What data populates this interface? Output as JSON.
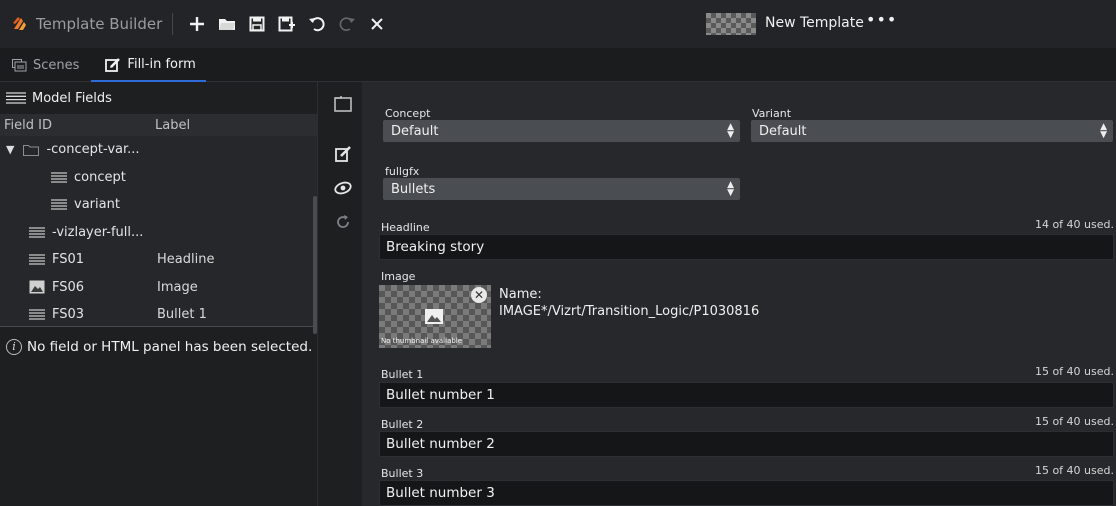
{
  "app": {
    "title": "Template Builder",
    "template_name": "New Template",
    "more": "•••"
  },
  "toolbar": {
    "items": [
      "add-icon",
      "open-folder-icon",
      "save-icon",
      "save-as-icon",
      "undo-icon",
      "redo-icon",
      "close-icon"
    ]
  },
  "tabs": [
    {
      "label": "Scenes"
    },
    {
      "label": "Fill-in form"
    }
  ],
  "left_panel": {
    "title": "Model Fields",
    "columns": {
      "field_id": "Field ID",
      "label": "Label"
    },
    "rows": [
      {
        "id": "-concept-var...",
        "label": "",
        "icon": "folder-icon",
        "indent": 0,
        "expanded": true
      },
      {
        "id": "concept",
        "label": "",
        "icon": "text-lines-icon",
        "indent": 1
      },
      {
        "id": "variant",
        "label": "",
        "icon": "text-lines-icon",
        "indent": 1
      },
      {
        "id": "-vizlayer-full...",
        "label": "",
        "icon": "text-lines-icon",
        "indent": 0
      },
      {
        "id": "FS01",
        "label": "Headline",
        "icon": "text-lines-icon",
        "indent": 0
      },
      {
        "id": "FS06",
        "label": "Image",
        "icon": "image-icon",
        "indent": 0
      },
      {
        "id": "FS03",
        "label": "Bullet 1",
        "icon": "text-lines-icon",
        "indent": 0
      }
    ],
    "status": "No field or HTML panel has been selected."
  },
  "form": {
    "concept": {
      "label": "Concept",
      "value": "Default"
    },
    "variant": {
      "label": "Variant",
      "value": "Default"
    },
    "fullgfx": {
      "label": "fullgfx",
      "value": "Bullets"
    },
    "headline": {
      "label": "Headline",
      "value": "Breaking story",
      "count": "14 of 40 used."
    },
    "image": {
      "label": "Image",
      "name_label": "Name:",
      "name_value": "IMAGE*/Vizrt/Transition_Logic/P1030816",
      "no_thumb": "No thumbnail available"
    },
    "bullet1": {
      "label": "Bullet 1",
      "value": "Bullet number 1",
      "count": "15 of 40 used."
    },
    "bullet2": {
      "label": "Bullet 2",
      "value": "Bullet number 2",
      "count": "15 of 40 used."
    },
    "bullet3": {
      "label": "Bullet 3",
      "value": "Bullet number 3",
      "count": "15 of 40 used."
    }
  },
  "colors": {
    "accent": "#2f6ad9",
    "logo": "#f07a2a"
  }
}
